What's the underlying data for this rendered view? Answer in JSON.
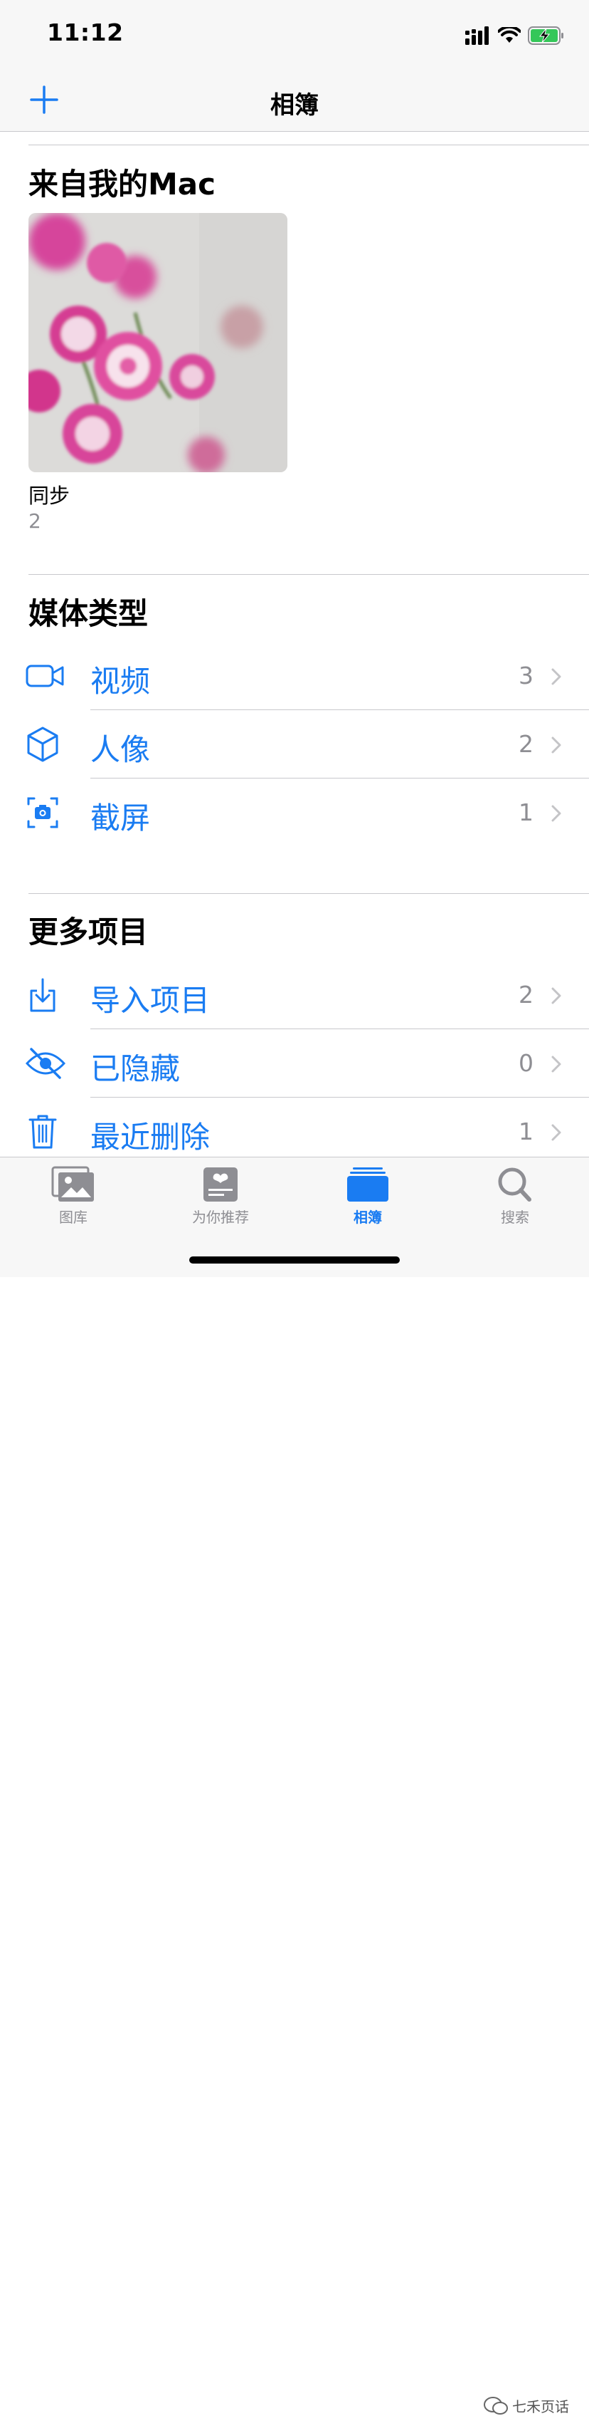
{
  "status_bar": {
    "time": "11:12"
  },
  "nav": {
    "title": "相簿"
  },
  "section_mac": {
    "title": "来自我的Mac",
    "album": {
      "name": "同步",
      "count": "2"
    }
  },
  "section_media": {
    "title": "媒体类型",
    "items": [
      {
        "label": "视频",
        "count": "3",
        "icon": "video-icon"
      },
      {
        "label": "人像",
        "count": "2",
        "icon": "cube-icon"
      },
      {
        "label": "截屏",
        "count": "1",
        "icon": "screenshot-icon"
      }
    ]
  },
  "section_more": {
    "title": "更多项目",
    "items": [
      {
        "label": "导入项目",
        "count": "2",
        "icon": "import-icon"
      },
      {
        "label": "已隐藏",
        "count": "0",
        "icon": "hidden-eye-icon"
      },
      {
        "label": "最近删除",
        "count": "1",
        "icon": "trash-icon"
      }
    ]
  },
  "tabs": [
    {
      "label": "图库",
      "icon": "library-icon"
    },
    {
      "label": "为你推荐",
      "icon": "for-you-icon"
    },
    {
      "label": "相簿",
      "icon": "albums-icon",
      "active": true
    },
    {
      "label": "搜索",
      "icon": "search-icon"
    }
  ],
  "watermark": {
    "text": "七禾页话"
  },
  "colors": {
    "accent": "#1a7cf2",
    "secondary_text": "#8e8e93",
    "bar_background": "#f7f7f7"
  }
}
